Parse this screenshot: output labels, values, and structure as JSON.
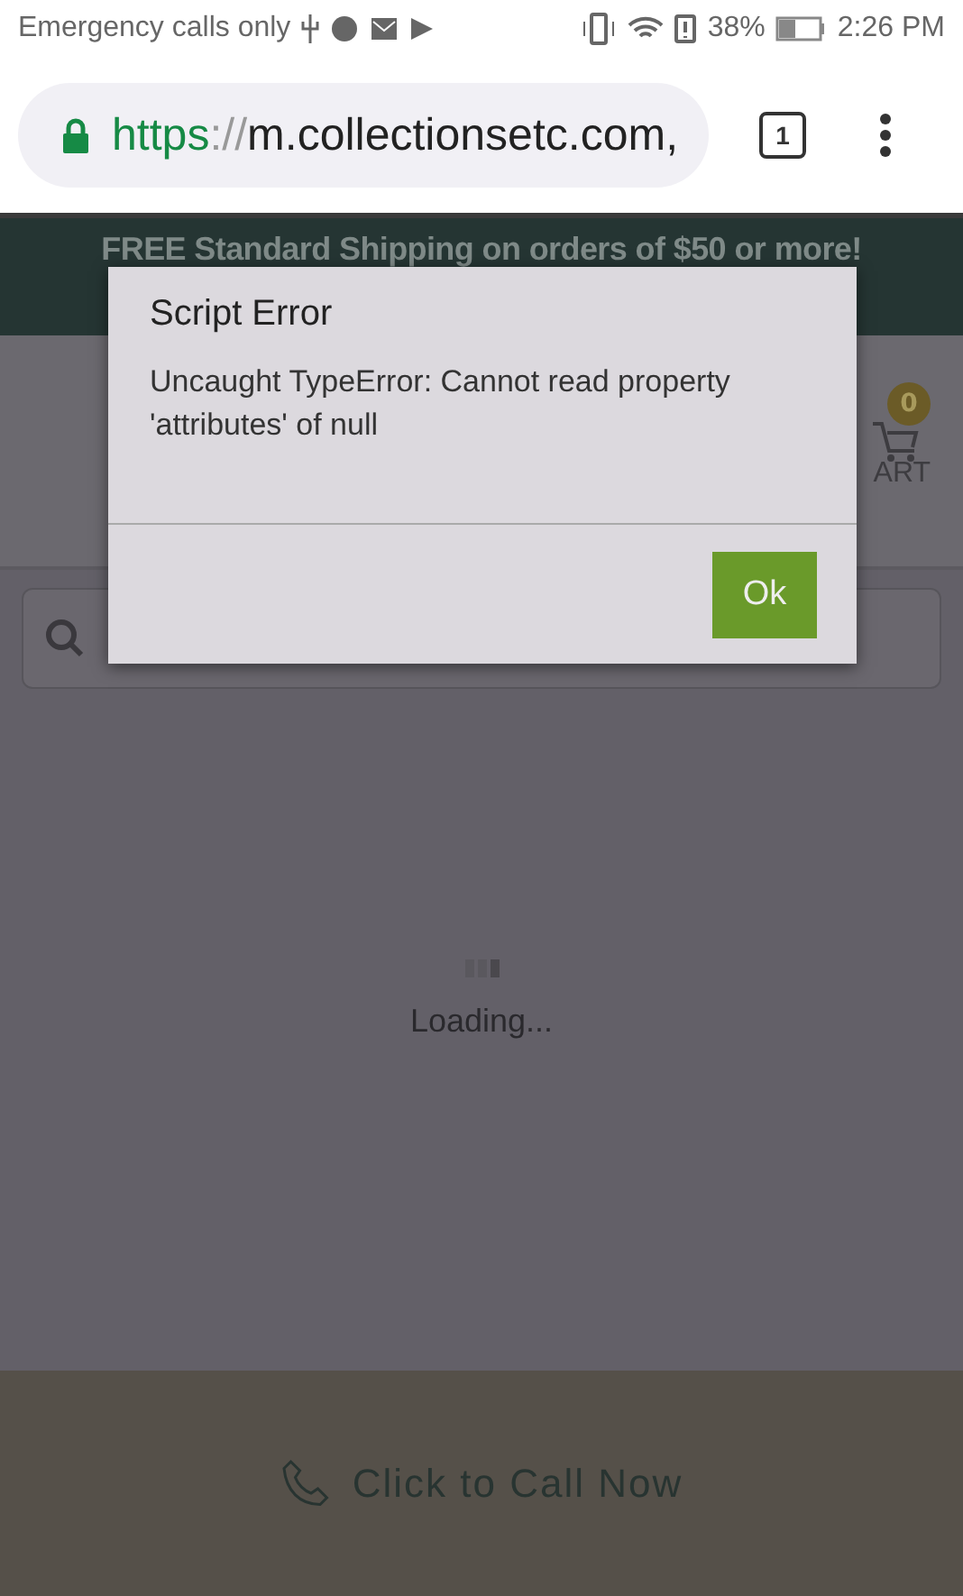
{
  "status_bar": {
    "carrier": "Emergency calls only",
    "battery": "38%",
    "time": "2:26 PM"
  },
  "browser": {
    "url_scheme": "https",
    "url_separator": "://",
    "url_host": "m.collectionsetc.com,",
    "tab_count": "1"
  },
  "page": {
    "banner": "FREE Standard Shipping on orders of $50 or more!",
    "cart_count": "0",
    "cart_label": "ART",
    "loading": "Loading...",
    "call_button": "Click to Call Now"
  },
  "dialog": {
    "title": "Script Error",
    "message": "Uncaught TypeError: Cannot read property 'attributes' of null",
    "buttons": [
      {
        "label": "Ok",
        "kind": "primary"
      }
    ]
  }
}
